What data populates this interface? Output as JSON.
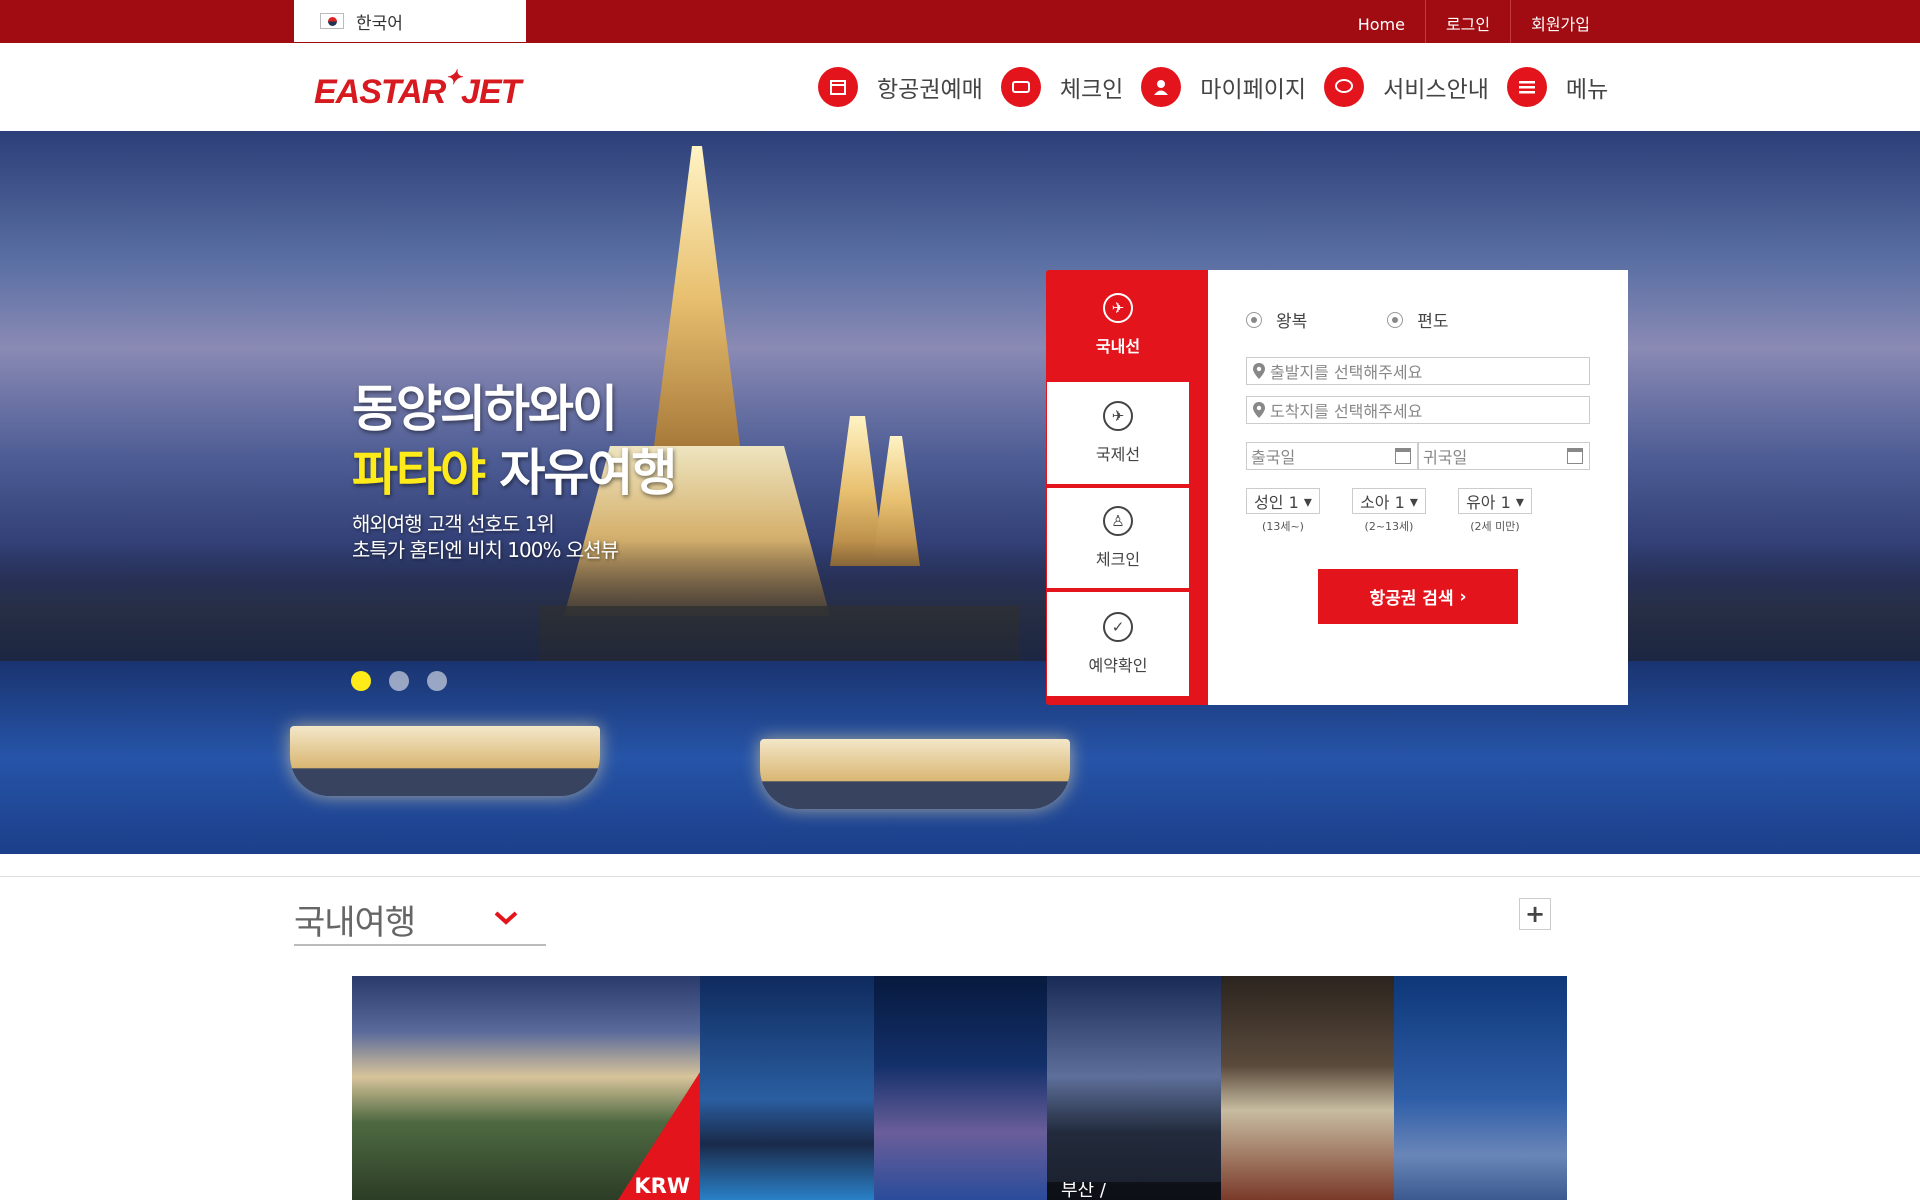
{
  "topbar": {
    "language": "한국어",
    "links": [
      "Home",
      "로그인",
      "회원가입"
    ]
  },
  "header": {
    "logo_text": "EASTAR JET",
    "nav": [
      {
        "icon": "calendar-icon",
        "label": "항공권예매"
      },
      {
        "icon": "ticket-icon",
        "label": "체크인"
      },
      {
        "icon": "user-icon",
        "label": "마이페이지"
      },
      {
        "icon": "chat-icon",
        "label": "서비스안내"
      },
      {
        "icon": "menu-icon",
        "label": "메뉴"
      }
    ]
  },
  "hero": {
    "title_line1": "동양의하와이",
    "title_highlight": "파타야",
    "title_rest": " 자유여행",
    "subtitle_line1": "해외여행 고객 선호도 1위",
    "subtitle_line2": "초특가 홈티엔 비치 100% 오션뷰",
    "slides": 3,
    "active_slide": 1
  },
  "booking": {
    "tabs": [
      {
        "label": "국내선",
        "icon": "plane-domestic-icon",
        "active": true
      },
      {
        "label": "국제선",
        "icon": "plane-international-icon",
        "active": false
      },
      {
        "label": "체크인",
        "icon": "checkin-icon",
        "active": false
      },
      {
        "label": "예약확인",
        "icon": "check-circle-icon",
        "active": false
      }
    ],
    "trip_types": [
      "왕복",
      "편도"
    ],
    "departure_placeholder": "출발지를 선택해주세요",
    "arrival_placeholder": "도착지를 선택해주세요",
    "depart_date_placeholder": "출국일",
    "return_date_placeholder": "귀국일",
    "passengers": [
      {
        "label": "성인 1",
        "note": "(13세~)"
      },
      {
        "label": "소아 1",
        "note": "(2~13세)"
      },
      {
        "label": "유아 1",
        "note": "(2세 미만)"
      }
    ],
    "search_label": "항공권 검색",
    "accent_color": "#e3141c"
  },
  "section": {
    "title": "국내여행",
    "more_label": "+",
    "price_badge": "KRW",
    "tile_caption": "부산 /"
  }
}
